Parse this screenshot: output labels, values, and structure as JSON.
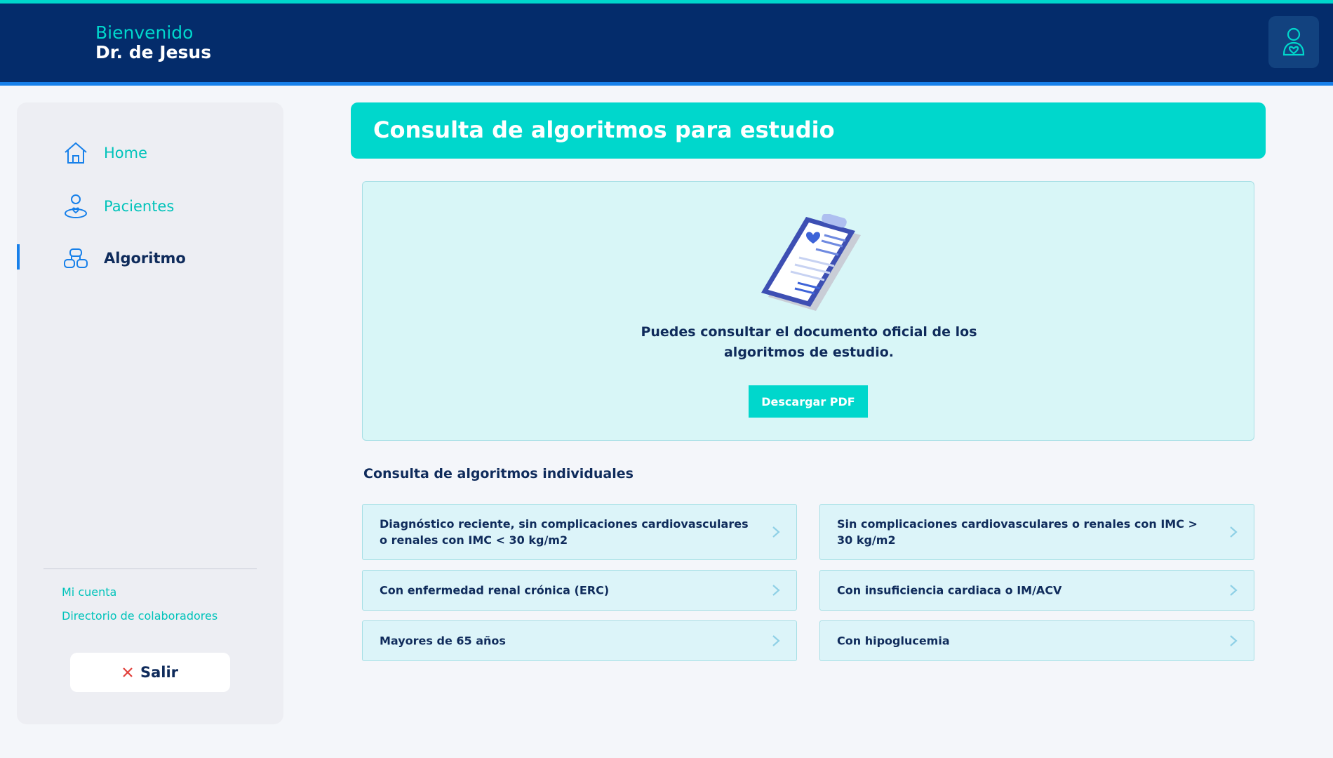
{
  "header": {
    "greeting": "Bienvenido",
    "doctor_name": "Dr. de Jesus"
  },
  "sidebar": {
    "items": [
      {
        "label": "Home",
        "icon": "home-icon"
      },
      {
        "label": "Pacientes",
        "icon": "patient-icon"
      },
      {
        "label": "Algoritmo",
        "icon": "algorithm-icon",
        "active": true
      }
    ],
    "links": [
      "Mi cuenta",
      "Directorio de colaboradores"
    ],
    "logout_label": "Salir"
  },
  "main": {
    "title": "Consulta de algoritmos para estudio",
    "pdf_card": {
      "text_line1": "Puedes consultar el documento oficial de los",
      "text_line2": "algoritmos de estudio.",
      "button_label": "Descargar PDF"
    },
    "section_title": "Consulta de algoritmos individuales",
    "algorithms": [
      "Diagnóstico reciente, sin complicaciones cardiovasculares o renales con IMC < 30 kg/m2",
      "Sin complicaciones cardiovasculares o renales con IMC > 30 kg/m2",
      "Con enfermedad renal crónica (ERC)",
      "Con insuficiencia cardiaca o IM/ACV",
      "Mayores de 65 años",
      "Con hipoglucemia"
    ]
  },
  "colors": {
    "navy": "#042c6b",
    "teal": "#00d7cc",
    "blue_accent": "#1780ea",
    "text_dark": "#0f2b5b"
  }
}
